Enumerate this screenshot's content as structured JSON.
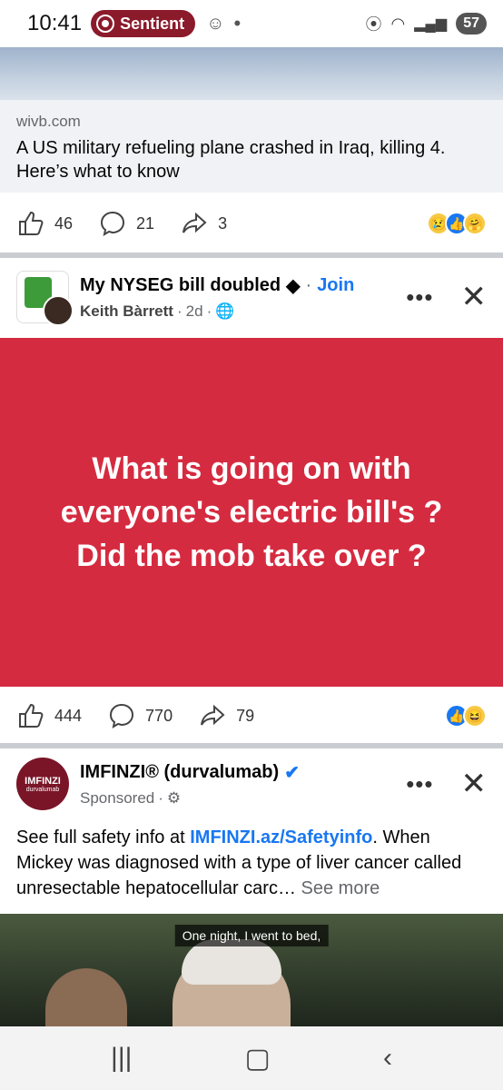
{
  "status_bar": {
    "time": "10:41",
    "notification_app": "Sentient",
    "battery": "57"
  },
  "link_post": {
    "domain": "wivb.com",
    "title": "A US military refueling plane crashed in Iraq, killing 4. Here’s what to know",
    "likes": "46",
    "comments": "21",
    "shares": "3"
  },
  "group_post": {
    "group_name": "My NYSEG bill doubled",
    "join_label": "Join",
    "author": "Keith Bàrrett",
    "time": "2d",
    "body": "What is going on with everyone's electric bill's ? Did the mob take over ?",
    "likes": "444",
    "comments": "770",
    "shares": "79",
    "background_color": "#d52b40"
  },
  "ad_post": {
    "advertiser": "IMFINZI® (durvalumab)",
    "sponsored_label": "Sponsored",
    "avatar_brand": "IMFINZI",
    "avatar_sub": "durvalumab",
    "text_prefix": "See full safety info at ",
    "link_text": "IMFINZI.az/Safetyinfo",
    "text_suffix": ". When Mickey was diagnosed with a type of liver cancer called unresectable hepatocellular carc… ",
    "see_more": "See more",
    "video_caption": "One night, I went to bed,"
  },
  "colors": {
    "facebook_blue": "#1877f2",
    "sentient_pill": "#8b1a2b"
  }
}
